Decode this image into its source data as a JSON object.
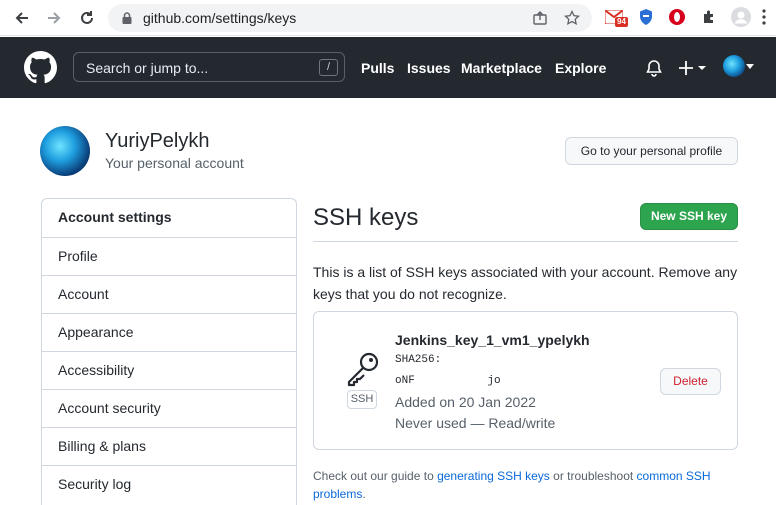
{
  "browser": {
    "url": "github.com/settings/keys",
    "gmail_badge": "94"
  },
  "header": {
    "search_placeholder": "Search or jump to...",
    "slash_hint": "/",
    "nav": [
      "Pulls",
      "Issues",
      "Marketplace",
      "Explore"
    ]
  },
  "profile": {
    "username": "YuriyPelykh",
    "subtitle": "Your personal account",
    "profile_button": "Go to your personal profile"
  },
  "sidebar": {
    "items": [
      {
        "label": "Account settings"
      },
      {
        "label": "Profile"
      },
      {
        "label": "Account"
      },
      {
        "label": "Appearance"
      },
      {
        "label": "Accessibility"
      },
      {
        "label": "Account security"
      },
      {
        "label": "Billing & plans"
      },
      {
        "label": "Security log"
      }
    ]
  },
  "main": {
    "title": "SSH keys",
    "new_button": "New SSH key",
    "description": "This is a list of SSH keys associated with your account. Remove any keys that you do not recognize.",
    "key": {
      "badge": "SSH",
      "name": "Jenkins_key_1_vm1_ypelykh",
      "fingerprint_label": "SHA256:",
      "fingerprint_value": "oNF           jo",
      "added": "Added on 20 Jan 2022",
      "usage": "Never used — Read/write",
      "delete_button": "Delete"
    },
    "footer": {
      "prefix": "Check out our guide to ",
      "link1": "generating SSH keys",
      "middle": " or troubleshoot ",
      "link2": "common SSH problems",
      "suffix": "."
    }
  },
  "colors": {
    "header_bg": "#24292f",
    "primary_green": "#2da44e",
    "link_blue": "#0969da",
    "danger_red": "#cf222e"
  }
}
